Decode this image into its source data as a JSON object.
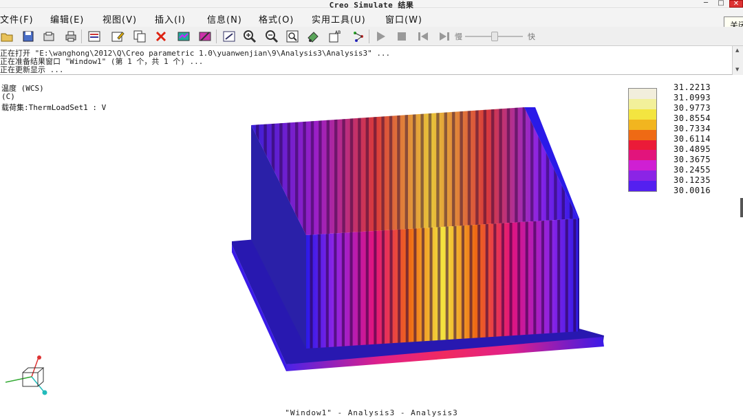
{
  "window": {
    "title": "Creo Simulate 结果"
  },
  "menu": {
    "items": [
      "文件(F)",
      "编辑(E)",
      "视图(V)",
      "插入(I)",
      "信息(N)",
      "格式(O)",
      "实用工具(U)",
      "窗口(W)"
    ],
    "tooltip": "关闭"
  },
  "toolbar": {
    "speed_slow": "慢",
    "speed_fast": "快"
  },
  "messages": [
    "正在打开 \"E:\\wanghong\\2012\\Q\\Creo parametric 1.0\\yuanwenjian\\9\\Analysis3\\Analysis3\" ...",
    "正在准备结果窗口 \"Window1\" (第 1 个，共 1 个) ...",
    "正在更新显示 ..."
  ],
  "result_info": {
    "quantity": "温度 (WCS)",
    "unit": "(C)",
    "loadset": "载荷集:ThermLoadSet1  :   V"
  },
  "legend": {
    "values": [
      "31.2213",
      "31.0993",
      "30.9773",
      "30.8554",
      "30.7334",
      "30.6114",
      "30.4895",
      "30.3675",
      "30.2455",
      "30.1235",
      "30.0016"
    ],
    "colors": [
      "#f2eedc",
      "#f2f09a",
      "#f3e540",
      "#f2b51f",
      "#ef6a14",
      "#eb1b38",
      "#e2147c",
      "#cf1fd3",
      "#8b24e6",
      "#5420f0",
      "#2a1ae8"
    ]
  },
  "footer": "\"Window1\" - Analysis3 - Analysis3"
}
